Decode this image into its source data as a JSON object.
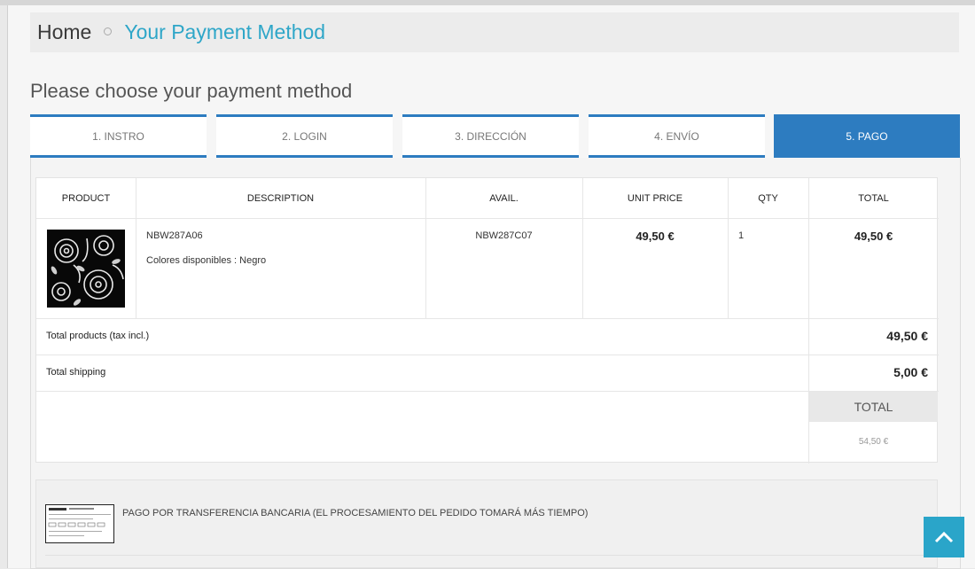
{
  "breadcrumb": {
    "home": "Home",
    "current": "Your Payment Method"
  },
  "page_title": "Please choose your payment method",
  "steps": [
    "1. INSTRO",
    "2. LOGIN",
    "3. DIRECCIÓN",
    "4. ENVÍO",
    "5. PAGO"
  ],
  "active_step": 4,
  "cart": {
    "headers": {
      "product": "PRODUCT",
      "description": "DESCRIPTION",
      "avail": "AVAIL.",
      "unit_price": "UNIT PRICE",
      "qty": "QTY",
      "total": "TOTAL"
    },
    "item": {
      "ref": "NBW287A06",
      "attributes": "Colores disponibles : Negro",
      "avail": "NBW287C07",
      "unit_price": "49,50 €",
      "qty": "1",
      "total": "49,50 €"
    },
    "summary": {
      "products_label": "Total products (tax incl.)",
      "products_value": "49,50 €",
      "shipping_label": "Total shipping",
      "shipping_value": "5,00 €",
      "total_label": "TOTAL",
      "total_value": "54,50 €"
    }
  },
  "payment_options": [
    {
      "label": "PAGO POR TRANSFERENCIA BANCARIA (EL PROCESAMIENTO DEL PEDIDO TOMARÁ MÁS TIEMPO)",
      "icon": "bank-transfer-icon"
    }
  ],
  "colors": {
    "accent": "#2d7cc0",
    "link": "#2ea6c8",
    "back_to_top": "#2aa5c9"
  }
}
